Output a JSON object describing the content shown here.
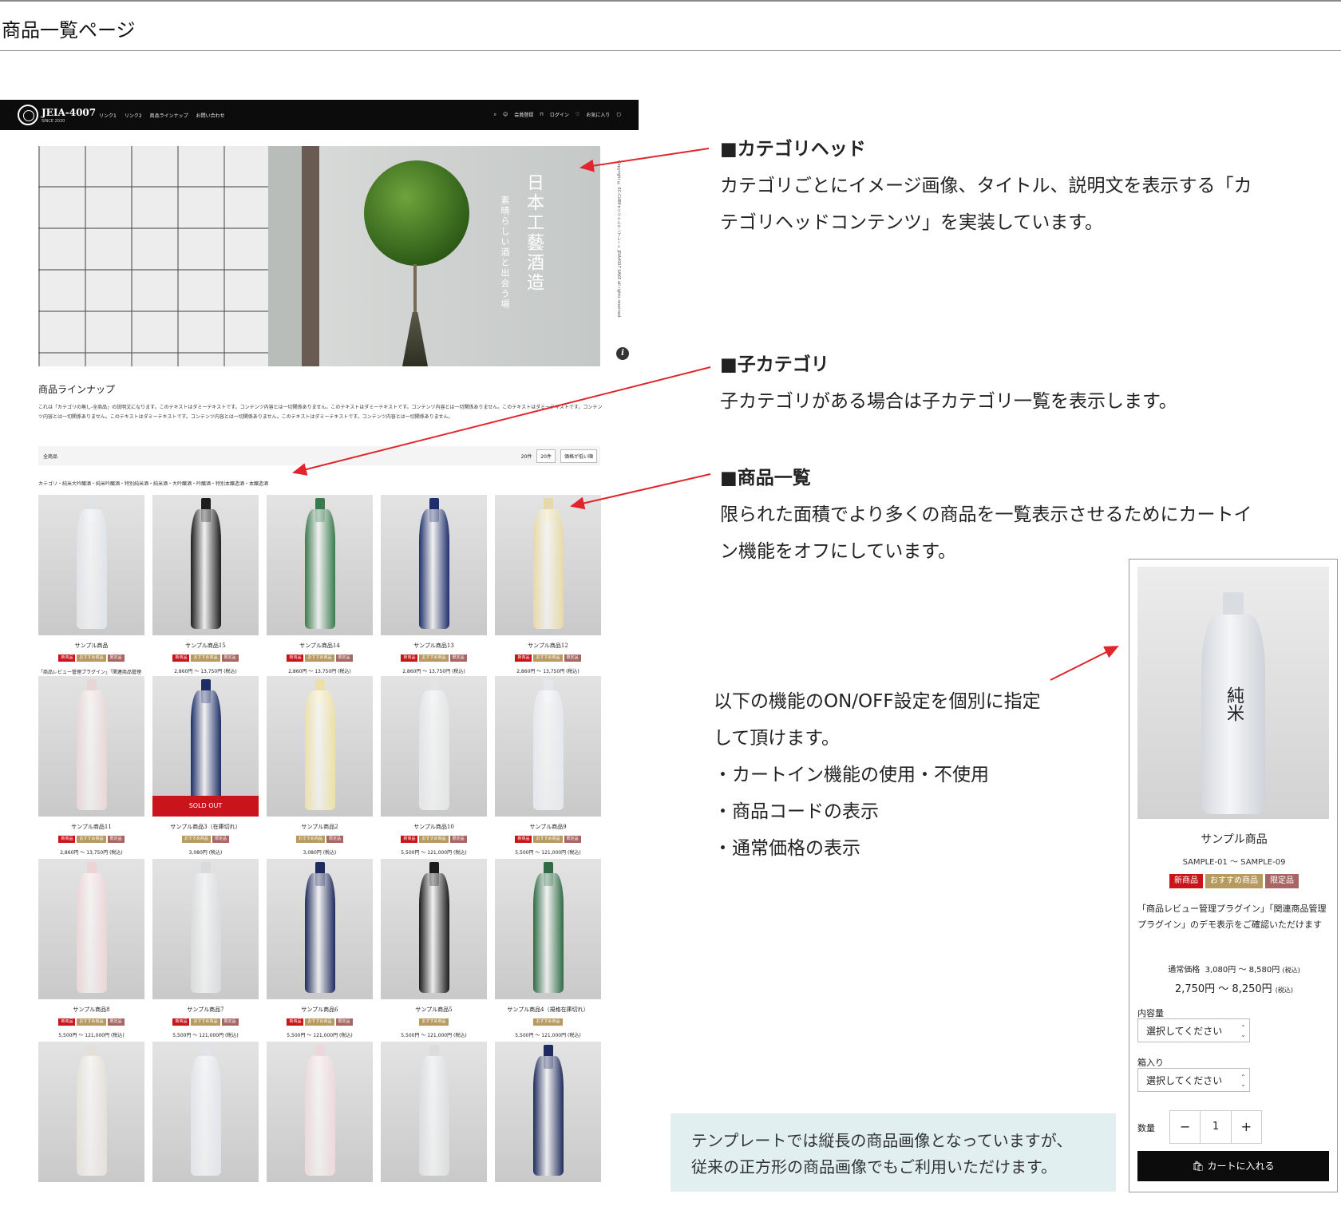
{
  "page_title": "商品一覧ページ",
  "mock": {
    "brand": "JEIA-4007",
    "brand_sub": "SINCE 2020",
    "nav_links": [
      "リンク1",
      "リンク2",
      "商品ラインナップ",
      "お問い合わせ"
    ],
    "nav_right": [
      "会員登録",
      "ログイン",
      "お気に入り"
    ],
    "hero_title": "日本工藝酒造",
    "hero_sub": "素晴らしい酒と出会う場",
    "copyright": "Copyright © EC-CUBEオリジナルテンプレート JEIA4007 SAKE all rights reserved.",
    "category_title": "商品ラインナップ",
    "category_desc": "これは「カテゴリの無し-全商品」の説明文になります。このテキストはダミーテキストです。コンテンツ内容とは一切関係ありません。このテキストはダミーテキストです。コンテンツ内容とは一切関係ありません。このテキストはダミーテキストです。コンテンツ内容とは一切関係ありません。このテキストはダミーテキストです。コンテンツ内容とは一切関係ありません。このテキストはダミーテキストです。コンテンツ内容とは一切関係ありません。",
    "sort_label": "全商品",
    "count_text": "20件",
    "count_select": "20件",
    "order_select": "価格が低い順",
    "child_categories": "カテゴリ・純米大吟醸酒・純米吟醸酒・特別純米酒・純米酒・大吟醸酒・吟醸酒・特別本醸造酒・本醸造酒",
    "tag_labels": {
      "new": "新商品",
      "rec": "おすすめ商品",
      "lim": "限定品"
    },
    "sold_out": "SOLD OUT",
    "row1": [
      {
        "name": "サンプル商品",
        "desc": "「商品レビュー管理プラグイン」「関連商品管理プラグイン」のデモを表示をご確認いただけます",
        "price": "2,750円 ～ 8,250円 (税込)",
        "color": "#dfe3e8"
      },
      {
        "name": "サンプル商品15",
        "desc": "",
        "price": "2,860円 ～ 13,750円 (税込)",
        "color": "#1d1d1d"
      },
      {
        "name": "サンプル商品14",
        "desc": "",
        "price": "2,860円 ～ 13,750円 (税込)",
        "color": "#3b7a4e"
      },
      {
        "name": "サンプル商品13",
        "desc": "",
        "price": "2,860円 ～ 13,750円 (税込)",
        "color": "#1f2f6a"
      },
      {
        "name": "サンプル商品12",
        "desc": "",
        "price": "2,860円 ～ 13,750円 (税込)",
        "color": "#e6d9a8"
      }
    ],
    "row2": [
      {
        "name": "サンプル商品11",
        "price": "2,860円 ～ 13,750円 (税込)",
        "color": "#e8d6d6"
      },
      {
        "name": "サンプル商品3（在庫切れ）",
        "price": "3,080円 (税込)",
        "color": "#1c2d66"
      },
      {
        "name": "サンプル商品2",
        "price": "3,080円 (税込)",
        "color": "#ece0a8"
      },
      {
        "name": "サンプル商品10",
        "price": "5,500円 ～ 121,000円 (税込)",
        "color": "#e2e4e6"
      },
      {
        "name": "サンプル商品9",
        "price": "5,500円 ～ 121,000円 (税込)",
        "color": "#e4e8ec"
      }
    ],
    "row3": [
      {
        "name": "サンプル商品8",
        "price": "5,500円 ～ 121,000円 (税込)",
        "color": "#ecd4d6"
      },
      {
        "name": "サンプル商品7",
        "price": "5,500円 ～ 121,000円 (税込)",
        "color": "#d8dadc"
      },
      {
        "name": "サンプル商品6",
        "price": "5,500円 ～ 121,000円 (税込)",
        "color": "#1f2b5c"
      },
      {
        "name": "サンプル商品5",
        "price": "5,500円 ～ 121,000円 (税込)",
        "color": "#1b1b1b"
      },
      {
        "name": "サンプル商品4（規格在庫切れ）",
        "price": "5,500円 ～ 121,000円 (税込)",
        "color": "#2f6b45"
      }
    ],
    "row4_colors": [
      "#e4e0d8",
      "#e0e4e8",
      "#ecd8da",
      "#dadcde",
      "#1f2b5c"
    ]
  },
  "annotations": {
    "a1_head": "■カテゴリヘッド",
    "a1_line1": "カテゴリごとにイメージ画像、タイトル、説明文を表示する「カ",
    "a1_line2": "テゴリヘッドコンテンツ」を実装しています。",
    "a2_head": "■子カテゴリ",
    "a2_line1": "子カテゴリがある場合は子カテゴリ一覧を表示します。",
    "a3_head": "■商品一覧",
    "a3_line1": "限られた面積でより多くの商品を一覧表示させるためにカートイ",
    "a3_line2": "ン機能をオフにしています。",
    "a4_line1": "以下の機能のON/OFF設定を個別に指定",
    "a4_line2": "して頂けます。",
    "a4_line3": "・カートイン機能の使用・不使用",
    "a4_line4": "・商品コードの表示",
    "a4_line5": "・通常価格の表示",
    "box_line1": "テンプレートでは縦長の商品画像となっていますが、",
    "box_line2": "従来の正方形の商品画像でもご利用いただけます。"
  },
  "detail": {
    "name": "サンプル商品",
    "code": "SAMPLE-01 ～ SAMPLE-09",
    "tags": [
      "新商品",
      "おすすめ商品",
      "限定品"
    ],
    "desc": "「商品レビュー管理プラグイン」「関連商品管理プラグイン」のデモ表示をご確認いただけます",
    "bottle_label": "純米",
    "regular_label": "通常価格",
    "regular_price": "3,080円 ～ 8,580円",
    "price": "2,750円 ～ 8,250円",
    "tax_note": "(税込)",
    "volume_label": "内容量",
    "volume_value": "選択してください",
    "box_label": "箱入り",
    "box_value": "選択してください",
    "qty_label": "数量",
    "qty_minus": "−",
    "qty_value": "1",
    "qty_plus": "+",
    "cart_label": "カートに入れる"
  },
  "colors": {
    "arrow": "#e0262c",
    "navbar": "#0c0c0c",
    "anno_box": "#e1eff1"
  }
}
